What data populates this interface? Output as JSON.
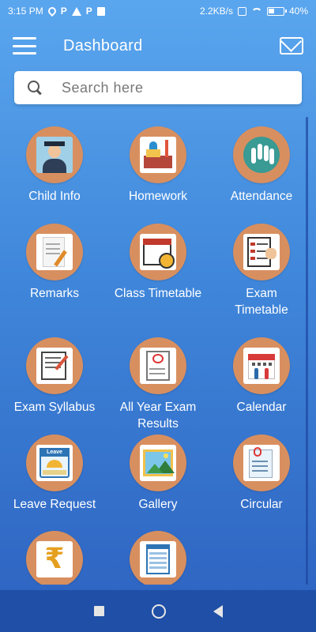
{
  "status_bar": {
    "time": "3:15 PM",
    "notif_icons": [
      "location-pin-icon",
      "p-icon",
      "warning-icon",
      "p-icon",
      "trash-icon"
    ],
    "net_speed": "2.2KB/s",
    "battery": "40%"
  },
  "app_bar": {
    "title": "Dashboard"
  },
  "search": {
    "placeholder": "Search here"
  },
  "tiles": [
    {
      "label": "Child Info",
      "icon": "child-graduate-icon"
    },
    {
      "label": "Homework",
      "icon": "homework-books-icon"
    },
    {
      "label": "Attendance",
      "icon": "raised-hands-icon"
    },
    {
      "label": "Remarks",
      "icon": "notepad-pencil-icon"
    },
    {
      "label": "Class Timetable",
      "icon": "calendar-clock-icon"
    },
    {
      "label": "Exam Timetable",
      "icon": "checklist-board-icon"
    },
    {
      "label": "Exam Syllabus",
      "icon": "syllabus-paper-icon"
    },
    {
      "label": "All Year Exam Results",
      "icon": "graded-paper-icon"
    },
    {
      "label": "Calendar",
      "icon": "calendar-people-icon"
    },
    {
      "label": "Leave Request",
      "icon": "leave-umbrella-icon"
    },
    {
      "label": "Gallery",
      "icon": "picture-frame-icon"
    },
    {
      "label": "Circular",
      "icon": "clipboard-notice-icon"
    },
    {
      "label": "",
      "icon": "rupee-icon"
    },
    {
      "label": "",
      "icon": "report-sheet-icon"
    }
  ],
  "colors": {
    "tile_circle": "#d88f5f",
    "nav_bar": "#1f4fa6"
  }
}
